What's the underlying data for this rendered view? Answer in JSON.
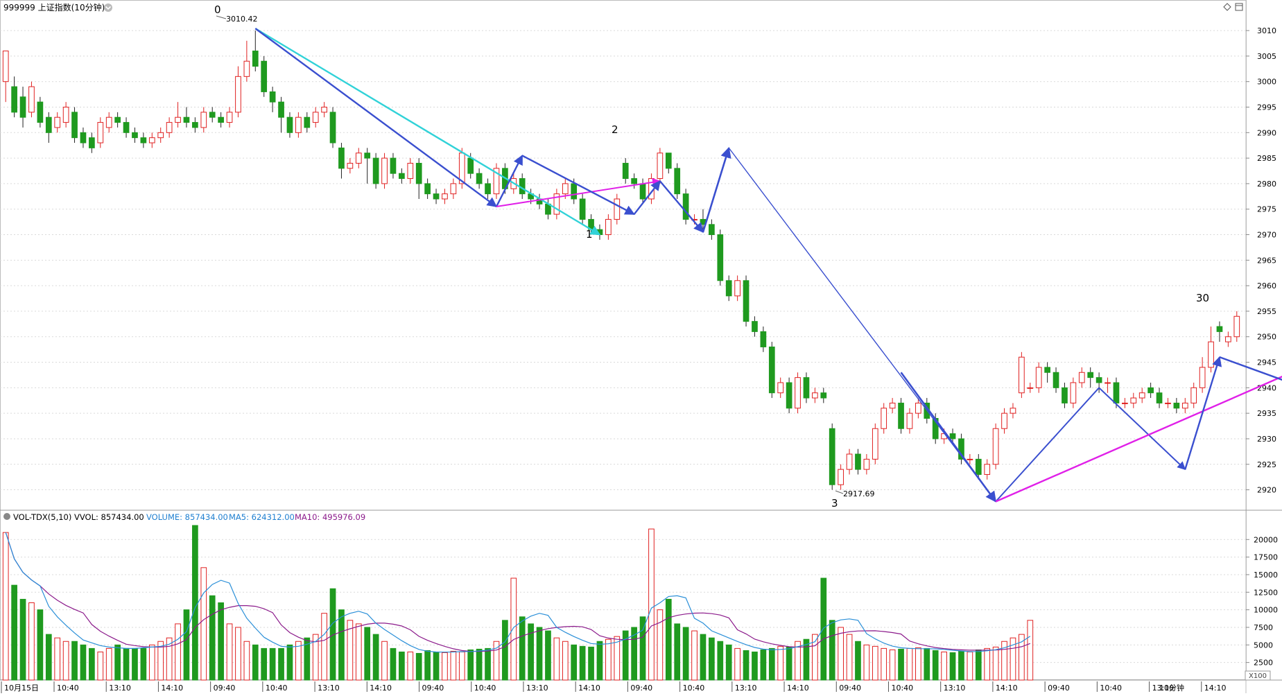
{
  "header": {
    "title": "999999 上证指数(10分钟)",
    "menu_icon": "chevron-down-icon",
    "right_icons": [
      "diamond-icon",
      "window-icon"
    ]
  },
  "indicator": {
    "name": "VOL-TDX(5,10)",
    "vvol": "VVOL: 857434.00",
    "volume": "VOLUME: 857434.00",
    "ma5": "MA5: 624312.00",
    "ma10": "MA10: 495976.09",
    "unit": "X100"
  },
  "time_axis": {
    "date": "10月15日",
    "session_labels": [
      "10:40",
      "13:10",
      "14:10",
      "09:40",
      "10:40",
      "13:10",
      "14:10",
      "09:40",
      "10:40",
      "13:10",
      "14:10",
      "09:40",
      "10:40",
      "13:10",
      "14:10",
      "09:40",
      "10:40",
      "13:10",
      "14:10",
      "09:40",
      "10:40",
      "13:10",
      "14:10"
    ],
    "corner": "10分钟"
  },
  "annotations": {
    "wave_labels": [
      "0",
      "1",
      "2",
      "3",
      "30"
    ],
    "price_labels": [
      "3010.42",
      "2917.69"
    ]
  },
  "colors": {
    "up": "#e02020",
    "down": "#1f9a1f",
    "grid": "#d9d9d9",
    "ma5": "#2a8fd8",
    "ma10": "#8b1a8b",
    "wave_blue": "#3a4fcf",
    "wave_cyan": "#31d2d8",
    "wave_magenta": "#e020e8"
  },
  "chart_data": [
    {
      "type": "candlestick",
      "title": "999999 上证指数(10分钟)",
      "ylim": [
        2916,
        3013
      ],
      "yticks": [
        3010,
        3005,
        3000,
        2995,
        2990,
        2985,
        2980,
        2975,
        2970,
        2965,
        2960,
        2955,
        2950,
        2945,
        2940,
        2935,
        2930,
        2925,
        2920
      ],
      "candles": [
        [
          3000,
          3006,
          3006,
          2996
        ],
        [
          2999,
          2994,
          3001,
          2993
        ],
        [
          2997,
          2993,
          2999,
          2991
        ],
        [
          2994,
          2999,
          3000,
          2993
        ],
        [
          2996,
          2992,
          2997,
          2991
        ],
        [
          2993,
          2990,
          2994,
          2988
        ],
        [
          2991,
          2993,
          2994,
          2990
        ],
        [
          2992,
          2995,
          2996,
          2991
        ],
        [
          2994,
          2989,
          2995,
          2988
        ],
        [
          2990,
          2988,
          2991,
          2987
        ],
        [
          2989,
          2987,
          2990,
          2986
        ],
        [
          2988,
          2992,
          2993,
          2987
        ],
        [
          2991,
          2993,
          2994,
          2990
        ],
        [
          2993,
          2992,
          2994,
          2991
        ],
        [
          2992,
          2990,
          2993,
          2989
        ],
        [
          2990,
          2989,
          2991,
          2988
        ],
        [
          2989,
          2988,
          2990,
          2987
        ],
        [
          2988,
          2989,
          2990,
          2987
        ],
        [
          2989,
          2990,
          2991,
          2988
        ],
        [
          2990,
          2992,
          2993,
          2989
        ],
        [
          2992,
          2993,
          2996,
          2991
        ],
        [
          2993,
          2992,
          2995,
          2991
        ],
        [
          2992,
          2991,
          2993,
          2990
        ],
        [
          2991,
          2994,
          2995,
          2990
        ],
        [
          2994,
          2993,
          2995,
          2992
        ],
        [
          2993,
          2992,
          2994,
          2991
        ],
        [
          2992,
          2994,
          2995,
          2991
        ],
        [
          2994,
          3001,
          3003,
          2993
        ],
        [
          3001,
          3004,
          3008,
          3000
        ],
        [
          3006,
          3003,
          3010,
          3002
        ],
        [
          3004,
          2998,
          3005,
          2997
        ],
        [
          2998,
          2996,
          2999,
          2994
        ],
        [
          2996,
          2993,
          2997,
          2990
        ],
        [
          2993,
          2990,
          2994,
          2989
        ],
        [
          2990,
          2993,
          2994,
          2989
        ],
        [
          2993,
          2991,
          2994,
          2990
        ],
        [
          2992,
          2994,
          2995,
          2991
        ],
        [
          2994,
          2995,
          2996,
          2993
        ],
        [
          2994,
          2988,
          2995,
          2987
        ],
        [
          2987,
          2983,
          2988,
          2981
        ],
        [
          2983,
          2984,
          2985,
          2982
        ],
        [
          2984,
          2986,
          2987,
          2983
        ],
        [
          2986,
          2985,
          2987,
          2980
        ],
        [
          2985,
          2980,
          2986,
          2979
        ],
        [
          2980,
          2985,
          2986,
          2979
        ],
        [
          2985,
          2982,
          2986,
          2981
        ],
        [
          2982,
          2981,
          2983,
          2980
        ],
        [
          2981,
          2984,
          2985,
          2980
        ],
        [
          2984,
          2980,
          2985,
          2977
        ],
        [
          2980,
          2978,
          2981,
          2977
        ],
        [
          2978,
          2977,
          2979,
          2976
        ],
        [
          2977,
          2978,
          2979,
          2976
        ],
        [
          2978,
          2980,
          2981,
          2977
        ],
        [
          2980,
          2986,
          2987,
          2979
        ],
        [
          2985,
          2982,
          2986,
          2981
        ],
        [
          2982,
          2980,
          2983,
          2979
        ],
        [
          2980,
          2978,
          2981,
          2977
        ],
        [
          2978,
          2983,
          2984,
          2977
        ],
        [
          2983,
          2979,
          2984,
          2978
        ],
        [
          2979,
          2981,
          2982,
          2978
        ],
        [
          2981,
          2978,
          2982,
          2977
        ],
        [
          2978,
          2977,
          2979,
          2976
        ],
        [
          2977,
          2976,
          2978,
          2975
        ],
        [
          2976,
          2974,
          2977,
          2973
        ],
        [
          2974,
          2978,
          2979,
          2973
        ],
        [
          2978,
          2980,
          2981,
          2977
        ],
        [
          2980,
          2977,
          2981,
          2976
        ],
        [
          2977,
          2973,
          2978,
          2972
        ],
        [
          2973,
          2971,
          2974,
          2970
        ],
        [
          2971,
          2970,
          2972,
          2969
        ],
        [
          2970,
          2973,
          2974,
          2969
        ],
        [
          2973,
          2977,
          2978,
          2972
        ],
        [
          2984,
          2981,
          2985,
          2980
        ],
        [
          2981,
          2980,
          2982,
          2979
        ],
        [
          2980,
          2977,
          2981,
          2976
        ],
        [
          2977,
          2981,
          2982,
          2976
        ],
        [
          2981,
          2986,
          2987,
          2980
        ],
        [
          2986,
          2983,
          2986,
          2982
        ],
        [
          2983,
          2978,
          2984,
          2977
        ],
        [
          2978,
          2973,
          2979,
          2972
        ],
        [
          2973,
          2973,
          2974,
          2972
        ],
        [
          2973,
          2972,
          2975,
          2971
        ],
        [
          2972,
          2970,
          2973,
          2969
        ],
        [
          2970,
          2961,
          2971,
          2960
        ],
        [
          2961,
          2958,
          2962,
          2957
        ],
        [
          2958,
          2961,
          2962,
          2957
        ],
        [
          2961,
          2953,
          2962,
          2952
        ],
        [
          2953,
          2951,
          2954,
          2950
        ],
        [
          2951,
          2948,
          2952,
          2947
        ],
        [
          2948,
          2939,
          2949,
          2938
        ],
        [
          2939,
          2941,
          2942,
          2938
        ],
        [
          2941,
          2936,
          2942,
          2935
        ],
        [
          2936,
          2942,
          2943,
          2935
        ],
        [
          2942,
          2938,
          2943,
          2937
        ],
        [
          2938,
          2939,
          2940,
          2937
        ],
        [
          2939,
          2938,
          2940,
          2937
        ],
        [
          2932,
          2921,
          2933,
          2920
        ],
        [
          2921,
          2924,
          2925,
          2920
        ],
        [
          2924,
          2927,
          2928,
          2923
        ],
        [
          2927,
          2924,
          2928,
          2923
        ],
        [
          2924,
          2926,
          2927,
          2923
        ],
        [
          2926,
          2932,
          2933,
          2925
        ],
        [
          2932,
          2936,
          2937,
          2931
        ],
        [
          2936,
          2937,
          2938,
          2935
        ],
        [
          2937,
          2932,
          2938,
          2931
        ],
        [
          2932,
          2935,
          2936,
          2931
        ],
        [
          2935,
          2937,
          2938,
          2934
        ],
        [
          2937,
          2934,
          2938,
          2933
        ],
        [
          2934,
          2930,
          2935,
          2929
        ],
        [
          2930,
          2931,
          2932,
          2929
        ],
        [
          2931,
          2930,
          2932,
          2929
        ],
        [
          2930,
          2926,
          2931,
          2925
        ],
        [
          2926,
          2926,
          2927,
          2925
        ],
        [
          2926,
          2923,
          2927,
          2922
        ],
        [
          2923,
          2925,
          2926,
          2922
        ],
        [
          2925,
          2932,
          2933,
          2924
        ],
        [
          2932,
          2935,
          2936,
          2931
        ],
        [
          2935,
          2936,
          2937,
          2934
        ],
        [
          2939,
          2946,
          2947,
          2938
        ],
        [
          2940,
          2940,
          2941,
          2939
        ],
        [
          2940,
          2944,
          2945,
          2939
        ],
        [
          2944,
          2943,
          2945,
          2941
        ],
        [
          2943,
          2940,
          2944,
          2939
        ],
        [
          2940,
          2937,
          2941,
          2936
        ],
        [
          2937,
          2941,
          2942,
          2936
        ],
        [
          2941,
          2943,
          2944,
          2940
        ],
        [
          2943,
          2942,
          2944,
          2940
        ],
        [
          2942,
          2941,
          2943,
          2939
        ],
        [
          2941,
          2941,
          2942,
          2939
        ],
        [
          2941,
          2937,
          2942,
          2936
        ],
        [
          2937,
          2937,
          2938,
          2936
        ],
        [
          2937,
          2938,
          2939,
          2936
        ],
        [
          2938,
          2939,
          2940,
          2937
        ],
        [
          2940,
          2939,
          2941,
          2938
        ],
        [
          2939,
          2937,
          2940,
          2936
        ],
        [
          2937,
          2937,
          2938,
          2936
        ],
        [
          2937,
          2936,
          2938,
          2935
        ],
        [
          2936,
          2937,
          2938,
          2935
        ],
        [
          2937,
          2940,
          2941,
          2936
        ],
        [
          2940,
          2944,
          2946,
          2939
        ],
        [
          2944,
          2949,
          2952,
          2943
        ],
        [
          2952,
          2951,
          2953,
          2949
        ],
        [
          2949,
          2950,
          2951,
          2948
        ],
        [
          2950,
          2954,
          2955,
          2949
        ]
      ]
    },
    {
      "type": "bar",
      "title": "VOL-TDX(5,10)",
      "ylim": [
        0,
        22000
      ],
      "yticks": [
        20000,
        17500,
        15000,
        12500,
        10000,
        7500,
        5000,
        2500
      ],
      "volumes": [
        21000,
        13500,
        11500,
        11000,
        10000,
        6500,
        6000,
        5500,
        5500,
        5000,
        4500,
        4000,
        4500,
        5000,
        4500,
        4500,
        4500,
        5000,
        5500,
        6000,
        8000,
        10000,
        22000,
        16000,
        12000,
        11000,
        8000,
        7500,
        5500,
        5000,
        4500,
        4500,
        4500,
        5000,
        5500,
        6000,
        6500,
        9500,
        13000,
        10000,
        8500,
        8000,
        7500,
        6500,
        5500,
        4500,
        4000,
        4000,
        3800,
        4200,
        4000,
        3900,
        4100,
        4000,
        4300,
        4400,
        4500,
        5500,
        8500,
        14500,
        9000,
        8000,
        7500,
        7000,
        6000,
        5500,
        5000,
        4800,
        4700,
        5500,
        5800,
        6200,
        7000,
        7500,
        9000,
        21500,
        10000,
        11500,
        8000,
        7500,
        7000,
        6500,
        6000,
        5500,
        5000,
        4500,
        4200,
        4000,
        4300,
        4500,
        4800,
        4700,
        5500,
        5800,
        6500,
        14500,
        8500,
        7500,
        6500,
        5500,
        5000,
        4800,
        4500,
        4300,
        4400,
        4500,
        4600,
        4500,
        4200,
        4000,
        3900,
        4100,
        4000,
        4300,
        4500,
        4700,
        5500,
        6000,
        6500,
        8500
      ],
      "series_ma": [
        "MA5",
        "MA10"
      ]
    }
  ]
}
